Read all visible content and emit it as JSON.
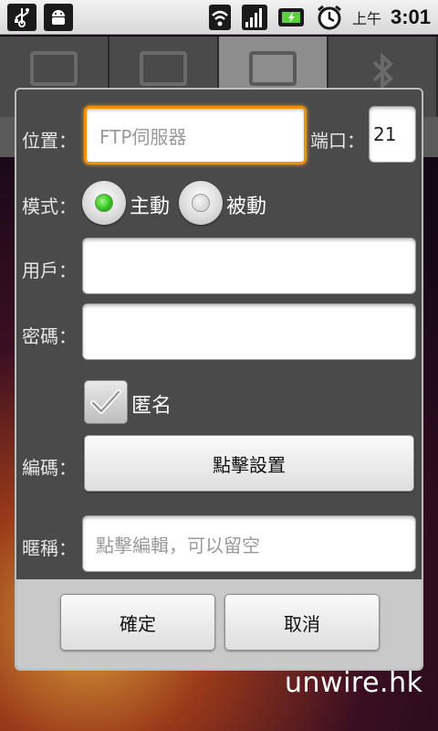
{
  "status_bar": {
    "icons": [
      "usb-icon",
      "android-debug-icon",
      "wifi-icon",
      "signal-icon",
      "battery-charging-icon",
      "alarm-icon"
    ],
    "ampm": "上午",
    "time": "3:01"
  },
  "background_tabs": [
    {
      "icon": "phone-storage-icon"
    },
    {
      "icon": "computer-icon"
    },
    {
      "icon": "network-folder-icon",
      "selected": true
    },
    {
      "icon": "bluetooth-icon"
    }
  ],
  "dialog": {
    "position_label": "位置：",
    "host_placeholder": "FTP伺服器",
    "host_value": "",
    "port_label": "端口：",
    "port_value": "21",
    "mode_label": "模式：",
    "mode_active_label": "主動",
    "mode_passive_label": "被動",
    "mode_selected": "主動",
    "user_label": "用戶：",
    "user_value": "",
    "password_label": "密碼：",
    "password_value": "",
    "anonymous_label": "匿名",
    "anonymous_checked": true,
    "encoding_label": "編碼：",
    "encoding_button": "點擊設置",
    "nickname_label": "暱稱：",
    "nickname_placeholder": "點擊編輯，可以留空",
    "ok_button": "確定",
    "cancel_button": "取消"
  },
  "colors": {
    "focus_border": "#f29000",
    "radio_selected": "#35c21d"
  },
  "watermark": "unwire.hk"
}
